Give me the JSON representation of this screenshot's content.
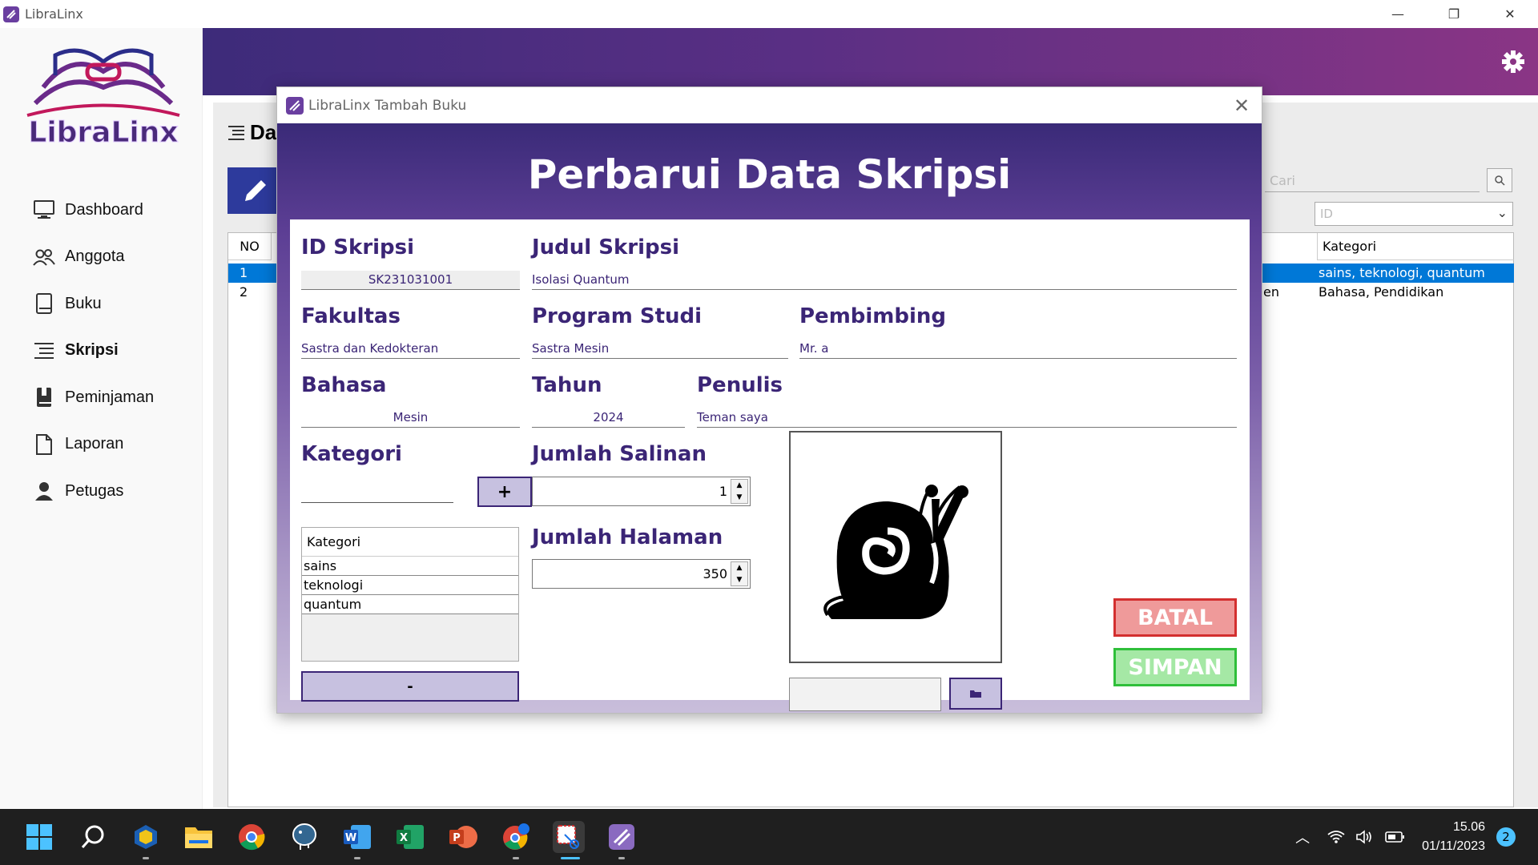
{
  "window": {
    "title": "LibraLinx",
    "controls": [
      "—",
      "❐",
      "✕"
    ]
  },
  "sidebar": {
    "logo_text": "LibraLinx",
    "items": [
      {
        "label": "Dashboard",
        "icon": "monitor-icon",
        "active": false
      },
      {
        "label": "Anggota",
        "icon": "users-icon",
        "active": false
      },
      {
        "label": "Buku",
        "icon": "book-icon",
        "active": false
      },
      {
        "label": "Skripsi",
        "icon": "list-icon",
        "active": true
      },
      {
        "label": "Peminjaman",
        "icon": "book-bookmark-icon",
        "active": false
      },
      {
        "label": "Laporan",
        "icon": "document-icon",
        "active": false
      },
      {
        "label": "Petugas",
        "icon": "person-icon",
        "active": false
      }
    ]
  },
  "background_content": {
    "title_fragment": "Da",
    "search_placeholder": "Cari",
    "filter_value": "ID",
    "table": {
      "col_no": "NO",
      "col_kategori": "Kategori",
      "rows": [
        {
          "no": "1",
          "frag": "",
          "kategori": "sains, teknologi, quantum",
          "selected": true
        },
        {
          "no": "2",
          "frag": "en",
          "kategori": "Bahasa, Pendidikan",
          "selected": false
        }
      ]
    }
  },
  "dialog": {
    "title": "LibraLinx Tambah Buku",
    "heading": "Perbarui Data Skripsi",
    "fields": {
      "id_skripsi": {
        "label": "ID Skripsi",
        "value": "SK231031001"
      },
      "judul": {
        "label": "Judul Skripsi",
        "value": "Isolasi Quantum"
      },
      "fakultas": {
        "label": "Fakultas",
        "value": "Sastra dan Kedokteran"
      },
      "prodi": {
        "label": "Program Studi",
        "value": "Sastra Mesin"
      },
      "pembimbing": {
        "label": "Pembimbing",
        "value": "Mr. a"
      },
      "bahasa": {
        "label": "Bahasa",
        "value": "Mesin"
      },
      "tahun": {
        "label": "Tahun",
        "value": "2024"
      },
      "penulis": {
        "label": "Penulis",
        "value": "Teman saya"
      },
      "kategori": {
        "label": "Kategori",
        "add_label": "+",
        "remove_label": "-",
        "list_header": "Kategori",
        "items": [
          "sains",
          "teknologi",
          "quantum"
        ]
      },
      "jumlah_salinan": {
        "label": "Jumlah Salinan",
        "value": "1"
      },
      "jumlah_halaman": {
        "label": "Jumlah Halaman",
        "value": "350"
      }
    },
    "buttons": {
      "batal": "BATAL",
      "simpan": "SIMPAN"
    },
    "colors": {
      "label": "#3b2576",
      "batal_border": "#d32f2f",
      "simpan_border": "#2fbf3a"
    }
  },
  "taskbar": {
    "apps": [
      "windows-start-icon",
      "search-icon",
      "virtualbox-icon",
      "file-explorer-icon",
      "chrome-icon",
      "postgres-icon",
      "word-icon",
      "excel-icon",
      "powerpoint-icon",
      "chrome-alt-icon",
      "snipping-tool-icon",
      "libralinx-icon"
    ],
    "time": "15.06",
    "date": "01/11/2023",
    "notifications": "2"
  }
}
